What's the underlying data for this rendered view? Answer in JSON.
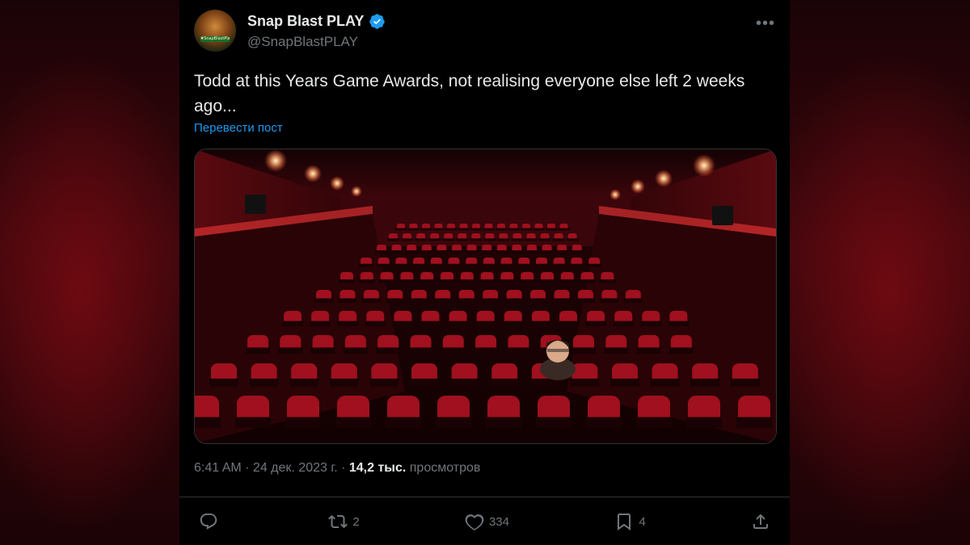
{
  "post": {
    "author_name": "Snap Blast PLAY",
    "author_handle": "@SnapBlastPLAY",
    "text": "Todd at this Years Game Awards, not realising everyone else left 2 weeks ago...",
    "translate_label": "Перевести пост",
    "time": "6:41 AM",
    "separator": " · ",
    "date": "24 дек. 2023 г.",
    "views_count": "14,2 тыс.",
    "views_label": "просмотров",
    "avatar_banner_text": "#SnapBlastPlay"
  },
  "actions": {
    "reply_count": "",
    "repost_count": "2",
    "like_count": "334",
    "bookmark_count": "4"
  },
  "colors": {
    "background": "#000000",
    "text": "#e7e9ea",
    "muted": "#71767b",
    "link": "#1d9bf0",
    "verified": "#1d9bf0",
    "seat_red": "#a0101e"
  },
  "icons": {
    "verified": "verified-badge-icon",
    "more": "more-horizontal-icon",
    "reply": "speech-bubble-icon",
    "repost": "repost-arrows-icon",
    "like": "heart-icon",
    "bookmark": "bookmark-icon",
    "share": "share-upload-icon"
  },
  "media": {
    "scene": "empty cinema hall with red seats and one person seated"
  }
}
